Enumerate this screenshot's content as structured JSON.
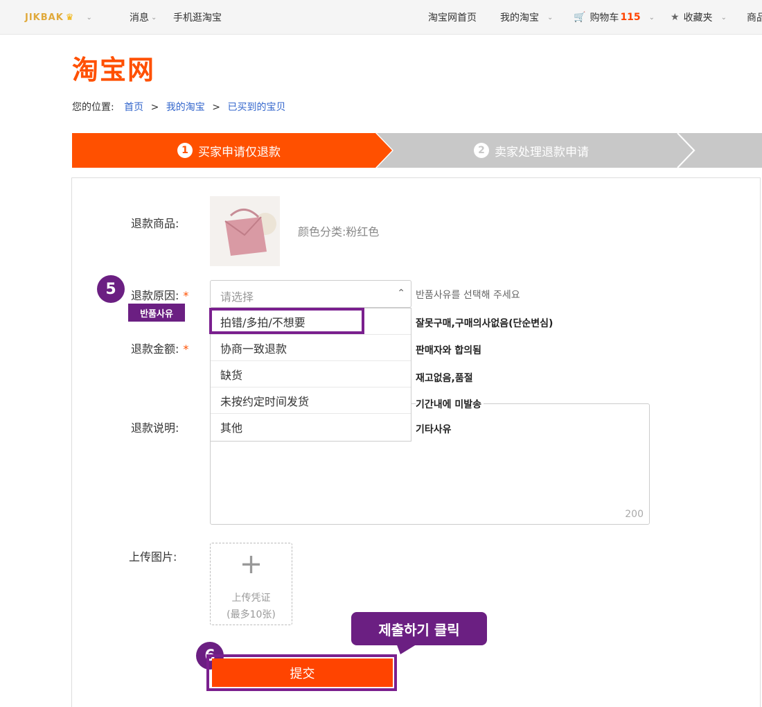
{
  "topbar": {
    "brand": "JIKBAK",
    "messages": "消息",
    "mobile": "手机逛淘宝",
    "home": "淘宝网首页",
    "my_taobao": "我的淘宝",
    "cart_label": "购物车",
    "cart_count": "115",
    "favorites": "收藏夹",
    "more": "商品"
  },
  "logo": "淘宝网",
  "breadcrumb": {
    "prefix": "您的位置:",
    "items": [
      "首页",
      "我的淘宝",
      "已买到的宝贝"
    ],
    "separator": ">"
  },
  "steps": [
    {
      "num": "1",
      "label": "买家申请仅退款",
      "active": true
    },
    {
      "num": "2",
      "label": "卖家处理退款申请",
      "active": false
    }
  ],
  "form": {
    "product_label": "退款商品:",
    "sku_text": "颜色分类:粉红色",
    "reason_label": "退款原因:",
    "required_mark": "*",
    "reason_placeholder": "请选择",
    "reason_options": [
      "拍错/多拍/不想要",
      "协商一致退款",
      "缺货",
      "未按约定时间发货",
      "其他"
    ],
    "amount_label": "退款金额:",
    "desc_label": "退款说明:",
    "desc_counter": "200",
    "upload_label": "上传图片:",
    "upload_line1": "上传凭证",
    "upload_line2": "(最多10张)",
    "submit_label": "提交"
  },
  "annotations": {
    "step5": "5",
    "step6": "6",
    "reason_tag": "반품사유",
    "select_hint": "반품사유를 선택해 주세요",
    "option_translations": [
      "잘못구매,구매의사없음(단순변심)",
      "판매자와 합의됨",
      "재고없음,품절",
      "기간내에 미발송",
      "기타사유"
    ],
    "submit_callout": "제출하기 클릭"
  },
  "colors": {
    "accent": "#ff5000",
    "annotation": "#6b1f82",
    "step_inactive": "#c8c8c8"
  }
}
